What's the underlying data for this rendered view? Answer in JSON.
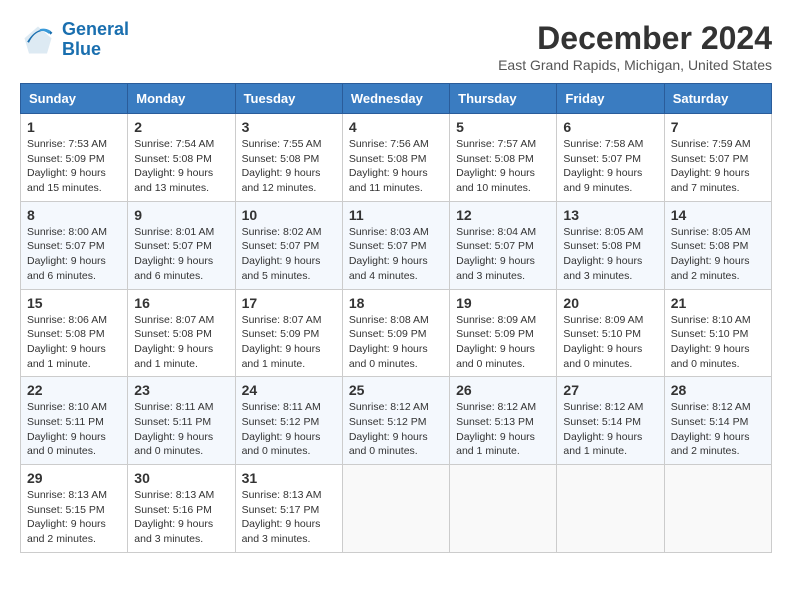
{
  "logo": {
    "line1": "General",
    "line2": "Blue"
  },
  "title": "December 2024",
  "location": "East Grand Rapids, Michigan, United States",
  "weekdays": [
    "Sunday",
    "Monday",
    "Tuesday",
    "Wednesday",
    "Thursday",
    "Friday",
    "Saturday"
  ],
  "weeks": [
    [
      {
        "day": "1",
        "info": "Sunrise: 7:53 AM\nSunset: 5:09 PM\nDaylight: 9 hours\nand 15 minutes."
      },
      {
        "day": "2",
        "info": "Sunrise: 7:54 AM\nSunset: 5:08 PM\nDaylight: 9 hours\nand 13 minutes."
      },
      {
        "day": "3",
        "info": "Sunrise: 7:55 AM\nSunset: 5:08 PM\nDaylight: 9 hours\nand 12 minutes."
      },
      {
        "day": "4",
        "info": "Sunrise: 7:56 AM\nSunset: 5:08 PM\nDaylight: 9 hours\nand 11 minutes."
      },
      {
        "day": "5",
        "info": "Sunrise: 7:57 AM\nSunset: 5:08 PM\nDaylight: 9 hours\nand 10 minutes."
      },
      {
        "day": "6",
        "info": "Sunrise: 7:58 AM\nSunset: 5:07 PM\nDaylight: 9 hours\nand 9 minutes."
      },
      {
        "day": "7",
        "info": "Sunrise: 7:59 AM\nSunset: 5:07 PM\nDaylight: 9 hours\nand 7 minutes."
      }
    ],
    [
      {
        "day": "8",
        "info": "Sunrise: 8:00 AM\nSunset: 5:07 PM\nDaylight: 9 hours\nand 6 minutes."
      },
      {
        "day": "9",
        "info": "Sunrise: 8:01 AM\nSunset: 5:07 PM\nDaylight: 9 hours\nand 6 minutes."
      },
      {
        "day": "10",
        "info": "Sunrise: 8:02 AM\nSunset: 5:07 PM\nDaylight: 9 hours\nand 5 minutes."
      },
      {
        "day": "11",
        "info": "Sunrise: 8:03 AM\nSunset: 5:07 PM\nDaylight: 9 hours\nand 4 minutes."
      },
      {
        "day": "12",
        "info": "Sunrise: 8:04 AM\nSunset: 5:07 PM\nDaylight: 9 hours\nand 3 minutes."
      },
      {
        "day": "13",
        "info": "Sunrise: 8:05 AM\nSunset: 5:08 PM\nDaylight: 9 hours\nand 3 minutes."
      },
      {
        "day": "14",
        "info": "Sunrise: 8:05 AM\nSunset: 5:08 PM\nDaylight: 9 hours\nand 2 minutes."
      }
    ],
    [
      {
        "day": "15",
        "info": "Sunrise: 8:06 AM\nSunset: 5:08 PM\nDaylight: 9 hours\nand 1 minute."
      },
      {
        "day": "16",
        "info": "Sunrise: 8:07 AM\nSunset: 5:08 PM\nDaylight: 9 hours\nand 1 minute."
      },
      {
        "day": "17",
        "info": "Sunrise: 8:07 AM\nSunset: 5:09 PM\nDaylight: 9 hours\nand 1 minute."
      },
      {
        "day": "18",
        "info": "Sunrise: 8:08 AM\nSunset: 5:09 PM\nDaylight: 9 hours\nand 0 minutes."
      },
      {
        "day": "19",
        "info": "Sunrise: 8:09 AM\nSunset: 5:09 PM\nDaylight: 9 hours\nand 0 minutes."
      },
      {
        "day": "20",
        "info": "Sunrise: 8:09 AM\nSunset: 5:10 PM\nDaylight: 9 hours\nand 0 minutes."
      },
      {
        "day": "21",
        "info": "Sunrise: 8:10 AM\nSunset: 5:10 PM\nDaylight: 9 hours\nand 0 minutes."
      }
    ],
    [
      {
        "day": "22",
        "info": "Sunrise: 8:10 AM\nSunset: 5:11 PM\nDaylight: 9 hours\nand 0 minutes."
      },
      {
        "day": "23",
        "info": "Sunrise: 8:11 AM\nSunset: 5:11 PM\nDaylight: 9 hours\nand 0 minutes."
      },
      {
        "day": "24",
        "info": "Sunrise: 8:11 AM\nSunset: 5:12 PM\nDaylight: 9 hours\nand 0 minutes."
      },
      {
        "day": "25",
        "info": "Sunrise: 8:12 AM\nSunset: 5:12 PM\nDaylight: 9 hours\nand 0 minutes."
      },
      {
        "day": "26",
        "info": "Sunrise: 8:12 AM\nSunset: 5:13 PM\nDaylight: 9 hours\nand 1 minute."
      },
      {
        "day": "27",
        "info": "Sunrise: 8:12 AM\nSunset: 5:14 PM\nDaylight: 9 hours\nand 1 minute."
      },
      {
        "day": "28",
        "info": "Sunrise: 8:12 AM\nSunset: 5:14 PM\nDaylight: 9 hours\nand 2 minutes."
      }
    ],
    [
      {
        "day": "29",
        "info": "Sunrise: 8:13 AM\nSunset: 5:15 PM\nDaylight: 9 hours\nand 2 minutes."
      },
      {
        "day": "30",
        "info": "Sunrise: 8:13 AM\nSunset: 5:16 PM\nDaylight: 9 hours\nand 3 minutes."
      },
      {
        "day": "31",
        "info": "Sunrise: 8:13 AM\nSunset: 5:17 PM\nDaylight: 9 hours\nand 3 minutes."
      },
      null,
      null,
      null,
      null
    ]
  ]
}
